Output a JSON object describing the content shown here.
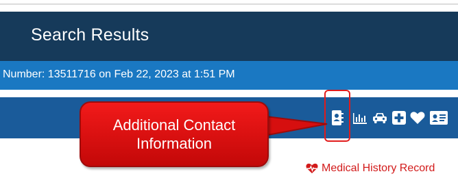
{
  "header": {
    "title": "Search Results"
  },
  "record_info": {
    "text": "Number: 13511716 on Feb 22, 2023 at 1:51 PM"
  },
  "toolbar": {
    "icons": [
      "contact-card-icon",
      "bar-chart-icon",
      "car-icon",
      "medical-plus-icon",
      "heart-icon",
      "id-card-icon"
    ]
  },
  "callout": {
    "line1": "Additional Contact",
    "line2": "Information"
  },
  "links": {
    "medical_history": "Medical History Record"
  },
  "colors": {
    "header_bg": "#163a5a",
    "number_bar_bg": "#1a78c2",
    "icon_bar_bg": "#1a5b9a",
    "callout_red": "#e31414",
    "link_red": "#d21a1a"
  }
}
